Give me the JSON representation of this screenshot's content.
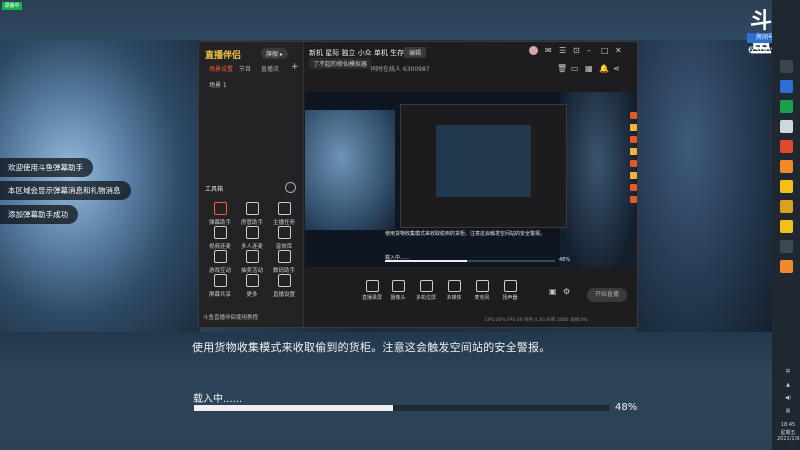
{
  "overlay": {
    "badge": "录播中"
  },
  "chat": {
    "messages": [
      "欢迎使用斗鱼弹幕助手",
      "本区域会显示弹幕消息和礼物消息",
      "添加弹幕助手成功"
    ]
  },
  "game": {
    "story_text": "使用货物收集模式来收取偷到的货柜。注意这会触发空间站的安全警报。",
    "loading_label": "载入中......",
    "progress_percent": 48,
    "progress_text": "48%"
  },
  "room": {
    "logo_text": "斗鱼",
    "room_label": "房间号",
    "room_id": "6300987"
  },
  "assistant": {
    "brand": "直播伴侣",
    "brand_badge": "旗舰 ▸",
    "tabs": [
      "场景设置",
      "节目",
      "直播流"
    ],
    "scene_item": "场景 1",
    "live_title": "新机 星际 独立 小众 单机 生存!",
    "title_tag": "编辑",
    "category": "了不起的修仙模拟器",
    "stats": "同时在线人 6300987",
    "tools_title": "工具箱",
    "tools": [
      "弹幕助手",
      "房管助手",
      "主播任务",
      "视频连麦",
      "多人连麦",
      "音效库",
      "游戏互动",
      "抽奖活动",
      "数码助手",
      "屏幕共享",
      "更多",
      "直播设置"
    ],
    "notice": "斗鱼直播伴侣使用教程",
    "controls": [
      "直播录屏",
      "摄像头",
      "多机位屏",
      "多媒体",
      "麦克风",
      "扬声器"
    ],
    "start_button": "开始直播",
    "status": "CPU:20% FPS:30 内存:4.3G 码率:3000 丢帧:0%"
  },
  "taskbar": {
    "time": "18:45",
    "weekday": "星期五",
    "date": "2021/1/9",
    "lang": "中"
  }
}
